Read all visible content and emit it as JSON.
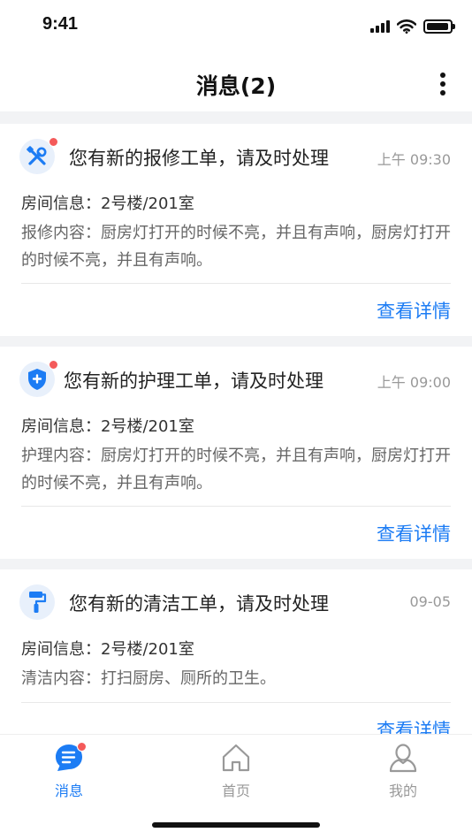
{
  "status_bar": {
    "time": "9:41"
  },
  "header": {
    "title": "消息(2)",
    "more_icon": "more-vertical-icon"
  },
  "messages": [
    {
      "icon": "tools-icon",
      "unread": true,
      "title": "您有新的报修工单，请及时处理",
      "time": "上午 09:30",
      "room": "房间信息：2号楼/201室",
      "detail": "报修内容：厨房灯打开的时候不亮，并且有声响，厨房灯打开的时候不亮，并且有声响。",
      "action": "查看详情"
    },
    {
      "icon": "shield-plus-icon",
      "unread": true,
      "title": "您有新的护理工单，请及时处理",
      "time": "上午 09:00",
      "room": "房间信息：2号楼/201室",
      "detail": "护理内容：厨房灯打开的时候不亮，并且有声响，厨房灯打开的时候不亮，并且有声响。",
      "action": "查看详情"
    },
    {
      "icon": "paint-roller-icon",
      "unread": false,
      "title": "您有新的清洁工单，请及时处理",
      "time": "09-05",
      "room": "房间信息：2号楼/201室",
      "detail": "清洁内容：打扫厨房、厕所的卫生。",
      "action": "查看详情"
    }
  ],
  "tab_bar": {
    "active": "messages",
    "tabs": [
      {
        "label": "消息",
        "icon": "message-icon",
        "badge": true
      },
      {
        "label": "首页",
        "icon": "home-icon",
        "badge": false
      },
      {
        "label": "我的",
        "icon": "user-icon",
        "badge": false
      }
    ]
  },
  "colors": {
    "accent": "#1c7cf4",
    "badge": "#f45a5a",
    "icon_bg": "#e8f0fb",
    "page_bg": "#f2f3f5"
  }
}
